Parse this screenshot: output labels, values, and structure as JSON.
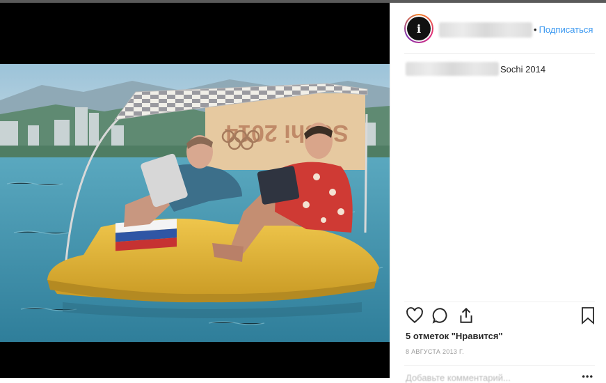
{
  "post": {
    "media_alt": "Painting of two men on a yellow pedal boat with tablets, Sochi",
    "account": {
      "avatar_letter": "i",
      "subscribe_label": "Подписаться",
      "separator": "•"
    },
    "caption": {
      "text": "Sochi 2014"
    },
    "likes_text": "5 отметок \"Нравится\"",
    "date_text": "8 АВГУСТА 2013 Г.",
    "comment_placeholder": "Добавьте комментарий...",
    "more_label": "•••"
  },
  "painting": {
    "canopy_text": "Sochi 2014"
  },
  "icons": {
    "like": "heart-icon",
    "comment": "comment-icon",
    "share": "share-icon",
    "save": "bookmark-icon"
  },
  "colors": {
    "link": "#3897f0",
    "text": "#262626",
    "boat": "#e2b437",
    "sea": "#4a9ab5"
  }
}
